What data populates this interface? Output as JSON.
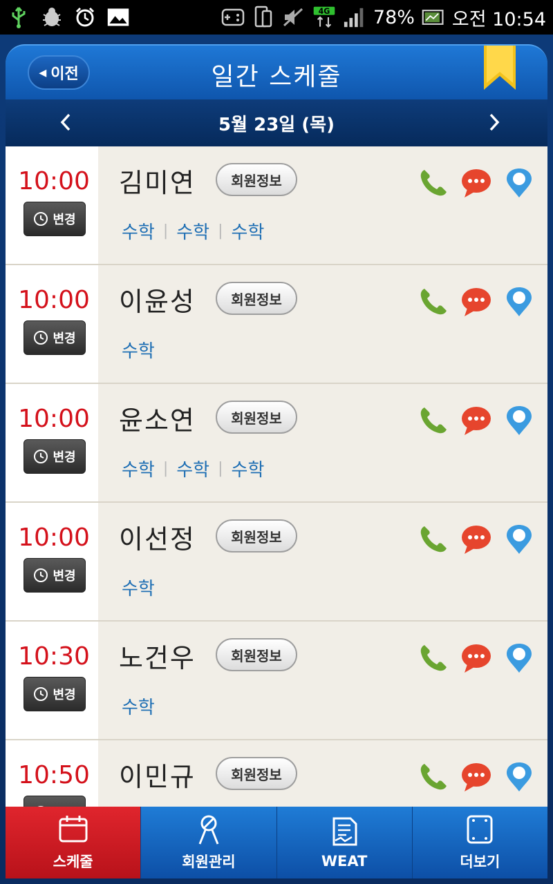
{
  "status_bar": {
    "battery": "78%",
    "time": "오전 10:54",
    "network": "4G"
  },
  "header": {
    "back_label": "이전",
    "title": "일간 스케줄"
  },
  "date_nav": {
    "date": "5월 23일 (목)"
  },
  "schedule": {
    "change_label": "변경",
    "info_label": "회원정보",
    "rows": [
      {
        "time": "10:00",
        "name": "김미연",
        "subjects": [
          "수학",
          "수학",
          "수학"
        ]
      },
      {
        "time": "10:00",
        "name": "이윤성",
        "subjects": [
          "수학"
        ]
      },
      {
        "time": "10:00",
        "name": "윤소연",
        "subjects": [
          "수학",
          "수학",
          "수학"
        ]
      },
      {
        "time": "10:00",
        "name": "이선정",
        "subjects": [
          "수학"
        ]
      },
      {
        "time": "10:30",
        "name": "노건우",
        "subjects": [
          "수학"
        ]
      },
      {
        "time": "10:50",
        "name": "이민규",
        "subjects": []
      }
    ]
  },
  "tabs": [
    {
      "label": "스케줄",
      "icon": "calendar-icon",
      "active": true
    },
    {
      "label": "회원관리",
      "icon": "member-icon",
      "active": false
    },
    {
      "label": "WEAT",
      "icon": "weat-icon",
      "active": false
    },
    {
      "label": "더보기",
      "icon": "more-icon",
      "active": false
    }
  ],
  "colors": {
    "time_red": "#d4111b",
    "subject_blue": "#1f6fb4",
    "phone_green": "#6aa531",
    "chat_red": "#e6452d",
    "map_blue": "#3b9be0",
    "tab_active": "#d01c23"
  }
}
